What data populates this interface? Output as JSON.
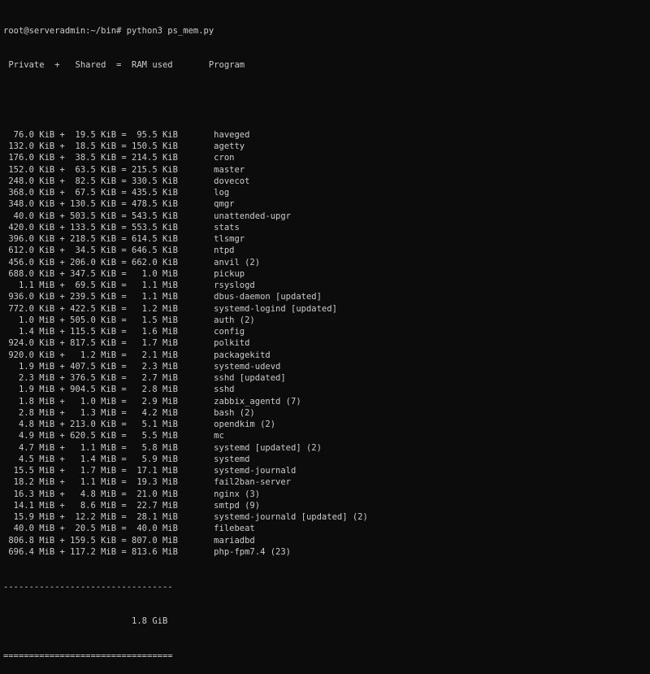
{
  "prompt_line": "root@serveradmin:~/bin# python3 ps_mem.py",
  "header": " Private  +   Shared  =  RAM used       Program",
  "rows": [
    "  76.0 KiB +  19.5 KiB =  95.5 KiB       haveged",
    " 132.0 KiB +  18.5 KiB = 150.5 KiB       agetty",
    " 176.0 KiB +  38.5 KiB = 214.5 KiB       cron",
    " 152.0 KiB +  63.5 KiB = 215.5 KiB       master",
    " 248.0 KiB +  82.5 KiB = 330.5 KiB       dovecot",
    " 368.0 KiB +  67.5 KiB = 435.5 KiB       log",
    " 348.0 KiB + 130.5 KiB = 478.5 KiB       qmgr",
    "  40.0 KiB + 503.5 KiB = 543.5 KiB       unattended-upgr",
    " 420.0 KiB + 133.5 KiB = 553.5 KiB       stats",
    " 396.0 KiB + 218.5 KiB = 614.5 KiB       tlsmgr",
    " 612.0 KiB +  34.5 KiB = 646.5 KiB       ntpd",
    " 456.0 KiB + 206.0 KiB = 662.0 KiB       anvil (2)",
    " 688.0 KiB + 347.5 KiB =   1.0 MiB       pickup",
    "   1.1 MiB +  69.5 KiB =   1.1 MiB       rsyslogd",
    " 936.0 KiB + 239.5 KiB =   1.1 MiB       dbus-daemon [updated]",
    " 772.0 KiB + 422.5 KiB =   1.2 MiB       systemd-logind [updated]",
    "   1.0 MiB + 505.0 KiB =   1.5 MiB       auth (2)",
    "   1.4 MiB + 115.5 KiB =   1.6 MiB       config",
    " 924.0 KiB + 817.5 KiB =   1.7 MiB       polkitd",
    " 920.0 KiB +   1.2 MiB =   2.1 MiB       packagekitd",
    "   1.9 MiB + 407.5 KiB =   2.3 MiB       systemd-udevd",
    "   2.3 MiB + 376.5 KiB =   2.7 MiB       sshd [updated]",
    "   1.9 MiB + 904.5 KiB =   2.8 MiB       sshd",
    "   1.8 MiB +   1.0 MiB =   2.9 MiB       zabbix_agentd (7)",
    "   2.8 MiB +   1.3 MiB =   4.2 MiB       bash (2)",
    "   4.8 MiB + 213.0 KiB =   5.1 MiB       opendkim (2)",
    "   4.9 MiB + 620.5 KiB =   5.5 MiB       mc",
    "   4.7 MiB +   1.1 MiB =   5.8 MiB       systemd [updated] (2)",
    "   4.5 MiB +   1.4 MiB =   5.9 MiB       systemd",
    "  15.5 MiB +   1.7 MiB =  17.1 MiB       systemd-journald",
    "  18.2 MiB +   1.1 MiB =  19.3 MiB       fail2ban-server",
    "  16.3 MiB +   4.8 MiB =  21.0 MiB       nginx (3)",
    "  14.1 MiB +   8.6 MiB =  22.7 MiB       smtpd (9)",
    "  15.9 MiB +  12.2 MiB =  28.1 MiB       systemd-journald [updated] (2)",
    "  40.0 MiB +  20.5 MiB =  40.0 MiB       filebeat",
    " 806.8 MiB + 159.5 KiB = 807.0 MiB       mariadbd",
    " 696.4 MiB + 117.2 MiB = 813.6 MiB       php-fpm7.4 (23)"
  ],
  "separator_top": "---------------------------------",
  "total": "                         1.8 GiB",
  "separator_bottom": "================================="
}
